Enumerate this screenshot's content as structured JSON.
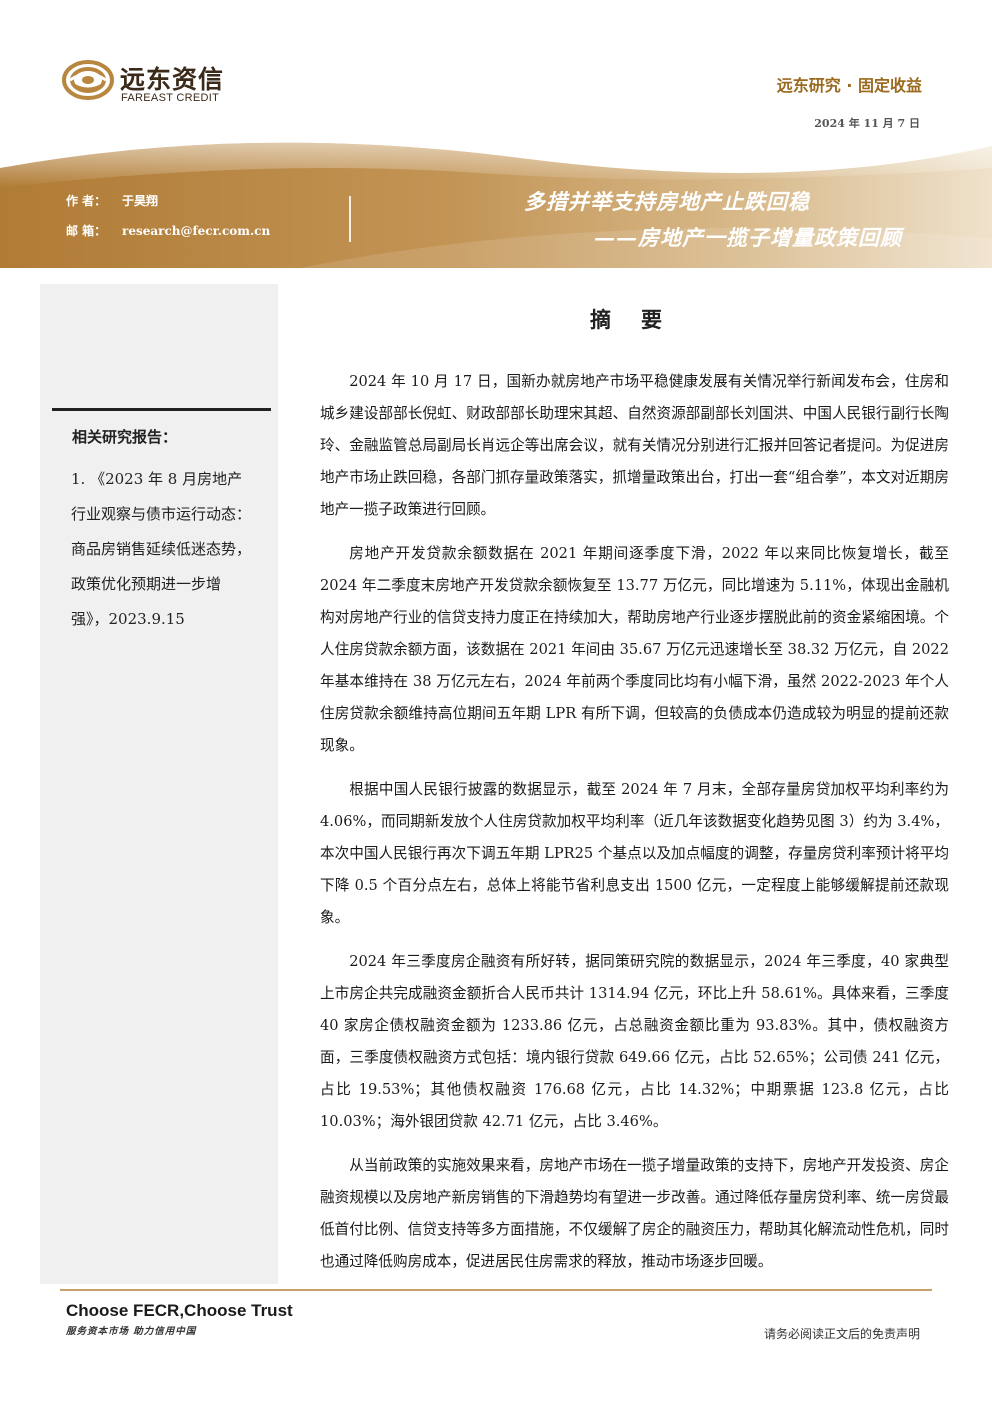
{
  "brand": {
    "name_cn": "远东资信",
    "name_en": "FAREAST CREDIT"
  },
  "header": {
    "series": "远东研究 · 固定收益",
    "date": "2024 年 11 月 7 日"
  },
  "author": {
    "author_label": "作    者：",
    "author_name": "于昊翔",
    "email_label": "邮    箱：",
    "email": "research@fecr.com.cn"
  },
  "title": {
    "main": "多措并举支持房地产止跌回稳",
    "sub": "——房地产一揽子增量政策回顾"
  },
  "sidebar": {
    "related_title": "相关研究报告：",
    "related_items": [
      "1. 《2023 年 8 月房地产行业观察与债市运行动态：商品房销售延续低迷态势，政策优化预期进一步增强》，2023.9.15"
    ]
  },
  "abstract": {
    "title": "摘要",
    "paragraphs": [
      "2024 年 10 月 17 日，国新办就房地产市场平稳健康发展有关情况举行新闻发布会，住房和城乡建设部部长倪虹、财政部部长助理宋其超、自然资源部副部长刘国洪、中国人民银行副行长陶玲、金融监管总局副局长肖远企等出席会议，就有关情况分别进行汇报并回答记者提问。为促进房地产市场止跌回稳，各部门抓存量政策落实，抓增量政策出台，打出一套“组合拳”，本文对近期房地产一揽子政策进行回顾。",
      "房地产开发贷款余额数据在 2021 年期间逐季度下滑，2022 年以来同比恢复增长，截至 2024 年二季度末房地产开发贷款余额恢复至 13.77 万亿元，同比增速为 5.11%，体现出金融机构对房地产行业的信贷支持力度正在持续加大，帮助房地产行业逐步摆脱此前的资金紧缩困境。个人住房贷款余额方面，该数据在 2021 年间由 35.67 万亿元迅速增长至 38.32 万亿元，自 2022 年基本维持在 38 万亿元左右，2024 年前两个季度同比均有小幅下滑，虽然 2022-2023 年个人住房贷款余额维持高位期间五年期 LPR 有所下调，但较高的负债成本仍造成较为明显的提前还款现象。",
      "根据中国人民银行披露的数据显示，截至 2024 年 7 月末，全部存量房贷加权平均利率约为 4.06%，而同期新发放个人住房贷款加权平均利率（近几年该数据变化趋势见图 3）约为 3.4%，本次中国人民银行再次下调五年期 LPR25 个基点以及加点幅度的调整，存量房贷利率预计将平均下降 0.5 个百分点左右，总体上将能节省利息支出 1500 亿元，一定程度上能够缓解提前还款现象。",
      "2024 年三季度房企融资有所好转，据同策研究院的数据显示，2024 年三季度，40 家典型上市房企共完成融资金额折合人民币共计 1314.94 亿元，环比上升 58.61%。具体来看，三季度 40 家房企债权融资金额为 1233.86 亿元，占总融资金额比重为 93.83%。其中，债权融资方面，三季度债权融资方式包括：境内银行贷款 649.66 亿元，占比 52.65%；公司债 241 亿元，占比 19.53%；其他债权融资 176.68 亿元，占比 14.32%；中期票据 123.8 亿元，占比 10.03%；海外银团贷款 42.71 亿元，占比 3.46%。",
      "从当前政策的实施效果来看，房地产市场在一揽子增量政策的支持下，房地产开发投资、房企融资规模以及房地产新房销售的下滑趋势均有望进一步改善。通过降低存量房贷利率、统一房贷最低首付比例、信贷支持等多方面措施，不仅缓解了房企的融资压力，帮助其化解流动性危机，同时也通过降低购房成本，促进居民住房需求的释放，推动市场逐步回暖。"
    ]
  },
  "footer": {
    "slogan_en": "Choose FECR,Choose Trust",
    "slogan_cn": "服务资本市场  助力信用中国",
    "disclaimer": "请务必阅读正文后的免责声明"
  },
  "colors": {
    "brand_gold": "#9a6a1e",
    "banner_gold": "#b8863f",
    "rule_gold": "#c9a16a"
  }
}
